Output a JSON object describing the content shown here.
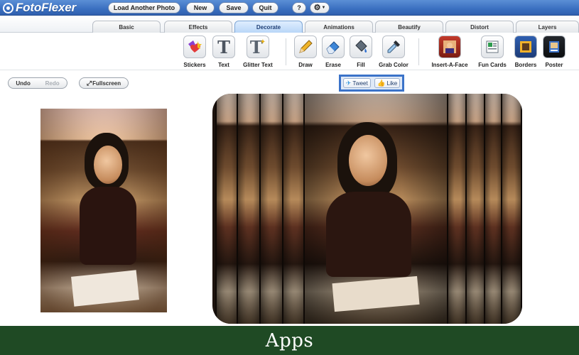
{
  "app": {
    "name": "FotoFlexer"
  },
  "topbar": {
    "buttons": [
      "Load Another Photo",
      "New",
      "Save",
      "Quit"
    ],
    "help_label": "?",
    "settings_icon": "gear-icon"
  },
  "tabs": [
    {
      "label": "Basic"
    },
    {
      "label": "Effects"
    },
    {
      "label": "Decorate",
      "active": true
    },
    {
      "label": "Animations"
    },
    {
      "label": "Beautify"
    },
    {
      "label": "Distort"
    },
    {
      "label": "Layers"
    }
  ],
  "tools": [
    {
      "label": "Stickers",
      "icon": "stickers-icon"
    },
    {
      "label": "Text",
      "icon": "text-icon"
    },
    {
      "label": "Glitter Text",
      "icon": "glitter-text-icon"
    },
    {
      "label": "Draw",
      "icon": "pencil-icon"
    },
    {
      "label": "Erase",
      "icon": "eraser-icon"
    },
    {
      "label": "Fill",
      "icon": "paint-bucket-icon"
    },
    {
      "label": "Grab Color",
      "icon": "eyedropper-icon"
    },
    {
      "label": "Insert-A-Face",
      "icon": "insert-face-icon"
    },
    {
      "label": "Fun Cards",
      "icon": "fun-cards-icon"
    },
    {
      "label": "Borders",
      "icon": "borders-icon"
    },
    {
      "label": "Poster",
      "icon": "poster-icon"
    }
  ],
  "history": {
    "undo": "Undo",
    "redo": "Redo"
  },
  "fullscreen": "Fullscreen",
  "social": {
    "tweet": "Tweet",
    "like": "Like"
  },
  "banner": "Apps",
  "colors": {
    "topbar": "#3a6fc0",
    "active_tab": "#b9d6f7",
    "banner": "#1f4a24",
    "share_border": "#3b73c9"
  }
}
